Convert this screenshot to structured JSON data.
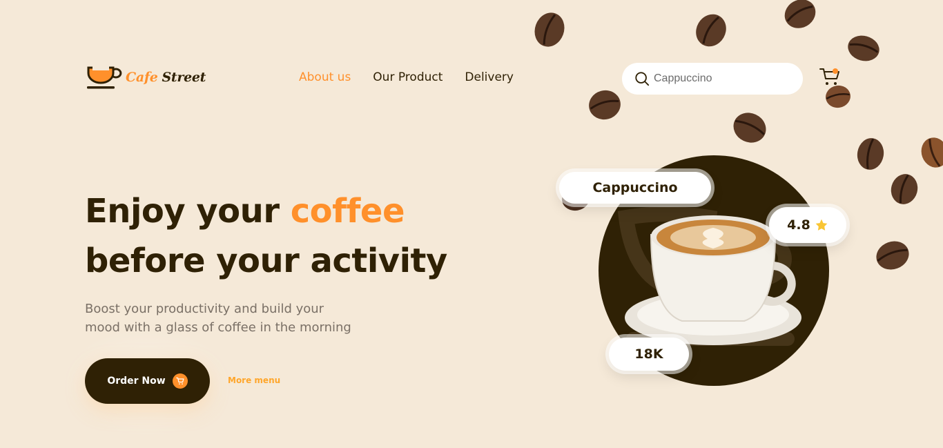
{
  "brand": {
    "name_part1": "Cafe",
    "name_part2": "Street"
  },
  "nav": [
    {
      "label": "About us",
      "active": true
    },
    {
      "label": "Our Product",
      "active": false
    },
    {
      "label": "Delivery",
      "active": false
    }
  ],
  "search": {
    "value": "",
    "placeholder": "Cappuccino",
    "icon": "search-icon"
  },
  "cart": {
    "icon": "cart-icon",
    "has_notification": true
  },
  "hero": {
    "headline_part1": "Enjoy your",
    "headline_accent": "coffee",
    "headline_line2": "before your activity",
    "subtext_line1": "Boost your productivity and build your",
    "subtext_line2": "mood with a glass of coffee in the morning",
    "order_button": "Order Now",
    "more_menu": "More menu"
  },
  "product_card": {
    "name": "Cappuccino",
    "rating": "4.8",
    "rating_icon": "star-icon",
    "count": "18K"
  },
  "colors": {
    "background": "#F5E9D8",
    "dark_brown": "#2F2105",
    "accent_orange": "#FF902B",
    "more_menu_gold": "#FFA62B",
    "star": "#F9C534"
  }
}
